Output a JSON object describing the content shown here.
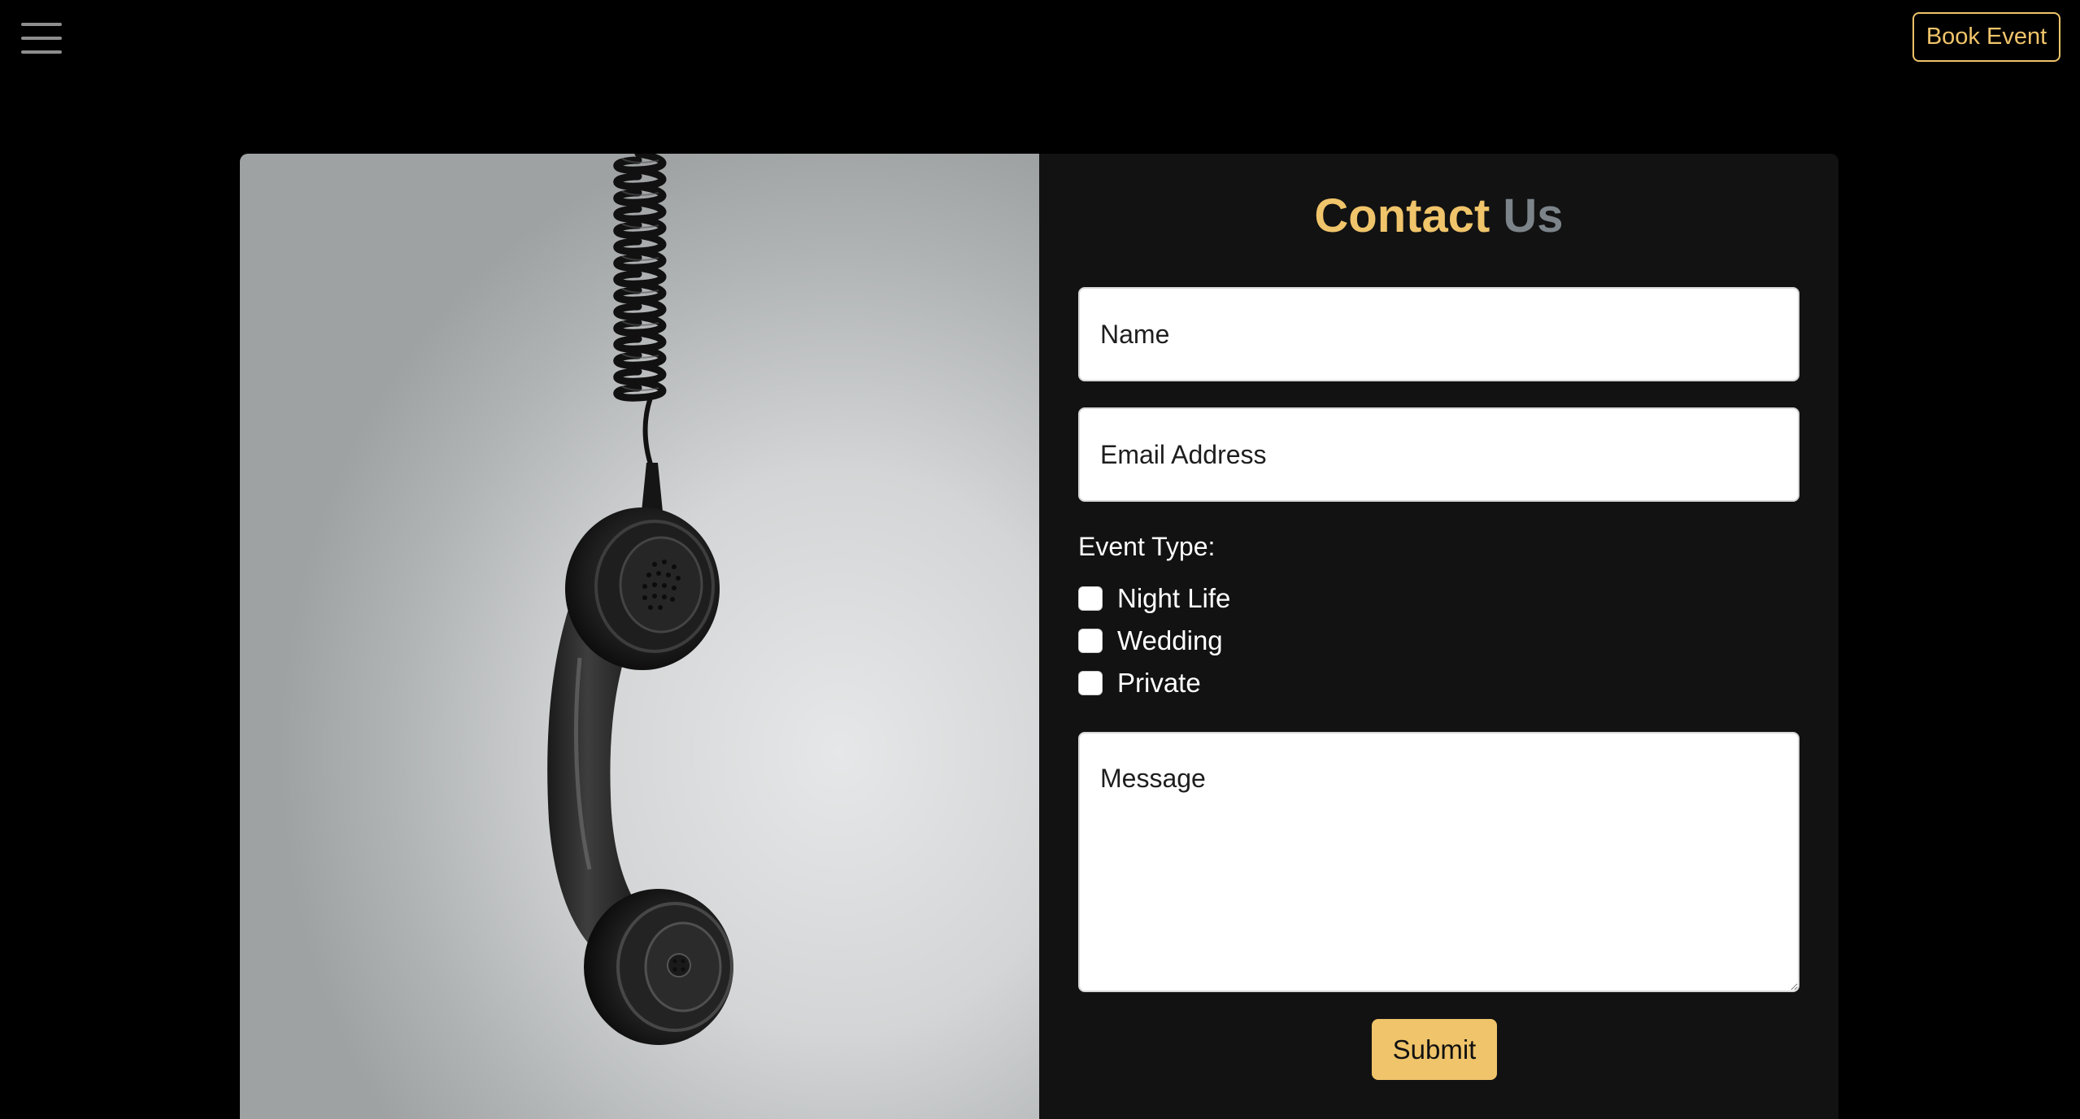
{
  "header": {
    "menu_icon": "hamburger-menu-icon",
    "book_event_label": "Book Event"
  },
  "contact": {
    "heading_word1": "Contact",
    "heading_word2": "Us",
    "name_placeholder": "Name",
    "email_placeholder": "Email Address",
    "event_type_label": "Event Type:",
    "event_types": [
      {
        "label": "Night Life",
        "checked": false
      },
      {
        "label": "Wedding",
        "checked": false
      },
      {
        "label": "Private",
        "checked": false
      }
    ],
    "message_placeholder": "Message",
    "submit_label": "Submit"
  },
  "image": {
    "subject": "hanging-telephone-handset"
  },
  "colors": {
    "accent": "#f0c46a",
    "muted_heading": "#7c848a",
    "page_background": "#000000",
    "panel_background": "#121212"
  }
}
